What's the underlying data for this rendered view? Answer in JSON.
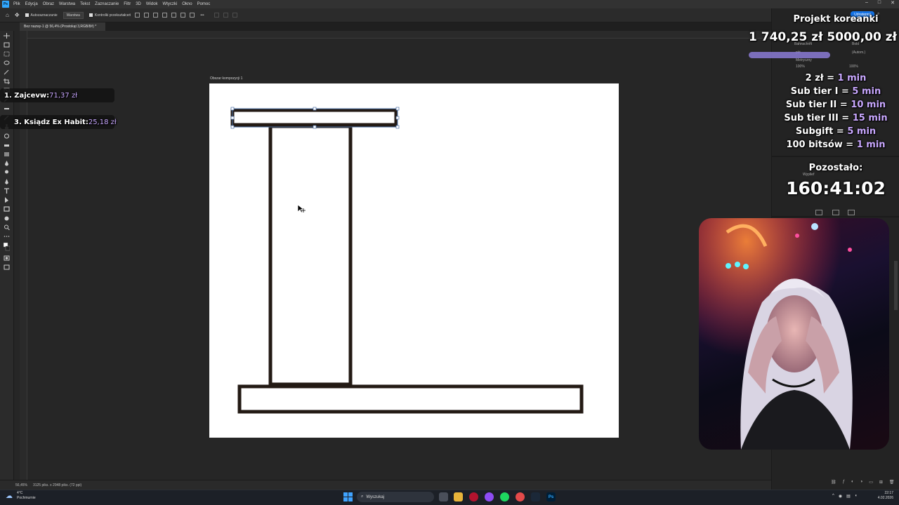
{
  "menu": {
    "app_logo": "Ps",
    "items": [
      "Plik",
      "Edycja",
      "Obraz",
      "Warstwa",
      "Tekst",
      "Zaznaczanie",
      "Filtr",
      "3D",
      "Widok",
      "Wtyczki",
      "Okno",
      "Pomoc"
    ]
  },
  "options": {
    "auto_select_label": "Autozaznaczanie",
    "layer_dropdown": "Warstwa",
    "transform_controls_label": "Kontrolki przekształceń",
    "more_label": "•••"
  },
  "document": {
    "tab_title": "Bez nazwy-1 @ 56,4% (Prostokąt 3,RGB/8#) *",
    "artboard_label": "Obszar kompozycji 1"
  },
  "status": {
    "zoom": "56,45%",
    "doc_size": "3125 piks. x 2948 piks. (72 ppi)"
  },
  "right_panel": {
    "share_button": "Udostępnij",
    "font_name": "Bahnschrift",
    "font_style": "Bold",
    "pt_field": "pkt",
    "auto_field": "(Autom.)",
    "metric_field": "Metryczny",
    "percent_100": "100%",
    "paragraph_label": "Wyplief"
  },
  "overlay": {
    "project_title": "Projekt koreanki",
    "goal_current": "1 740,25 zł",
    "goal_target": "5000,00 zł",
    "rules": [
      {
        "left": "2 zł = ",
        "right": "1 min"
      },
      {
        "left": "Sub tier I = ",
        "right": "5 min"
      },
      {
        "left": "Sub tier II = ",
        "right": "10 min"
      },
      {
        "left": "Sub tier III = ",
        "right": "15 min"
      },
      {
        "left": "Subgift = ",
        "right": "5 min"
      },
      {
        "left": "100 bitsów = ",
        "right": "1 min"
      }
    ],
    "remaining_label": "Pozostało:",
    "timer": "160:41:02",
    "donors": [
      {
        "name": "1. Zajcevw: ",
        "amount": "71,37 zł"
      },
      {
        "name": "3. Ksiądz Ex Habit: ",
        "amount": "25,18 zł"
      }
    ]
  },
  "taskbar": {
    "weather_temp": "4°C",
    "weather_desc": "Pochmurnie",
    "search_placeholder": "Wyszukaj",
    "time": "22:17",
    "date": "4.02.2026"
  },
  "colors": {
    "accent": "#31a8ff",
    "overlay_highlight": "#c9a8ff",
    "goal_bar": "#8b7bd6",
    "shape_stroke": "#231a14"
  }
}
